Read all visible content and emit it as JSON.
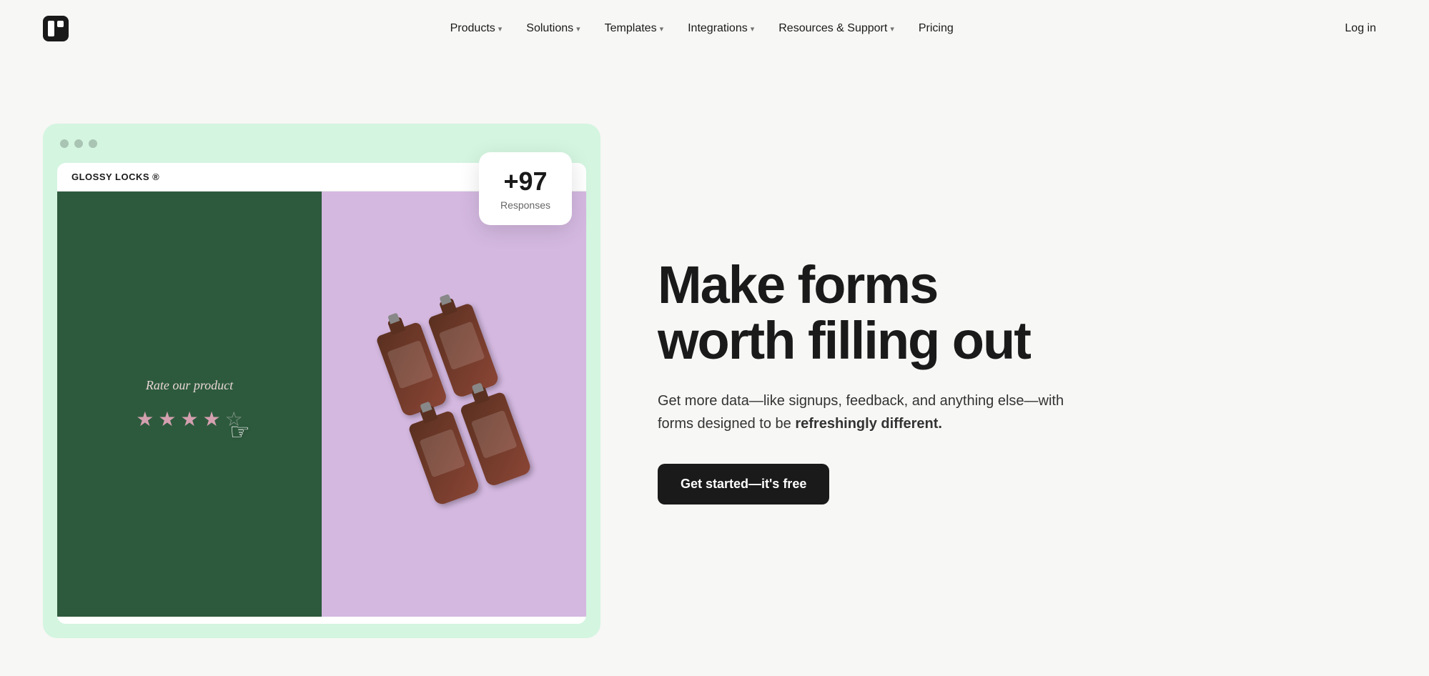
{
  "logo": {
    "alt": "Typeform logo"
  },
  "nav": {
    "links": [
      {
        "label": "Products",
        "hasDropdown": true
      },
      {
        "label": "Solutions",
        "hasDropdown": true
      },
      {
        "label": "Templates",
        "hasDropdown": true
      },
      {
        "label": "Integrations",
        "hasDropdown": true
      },
      {
        "label": "Resources & Support",
        "hasDropdown": true
      },
      {
        "label": "Pricing",
        "hasDropdown": false
      }
    ],
    "login_label": "Log in"
  },
  "illustration": {
    "brand": "GLOSSY LOCKS ®",
    "responses_count": "+97",
    "responses_label": "Responses",
    "rate_text": "Rate our product"
  },
  "hero": {
    "title_line1": "Make forms",
    "title_line2": "worth filling out",
    "subtitle_normal": "Get more data—like signups, feedback, and anything else—with forms designed to be ",
    "subtitle_bold": "refreshingly different.",
    "cta_label": "Get started—it's free"
  }
}
